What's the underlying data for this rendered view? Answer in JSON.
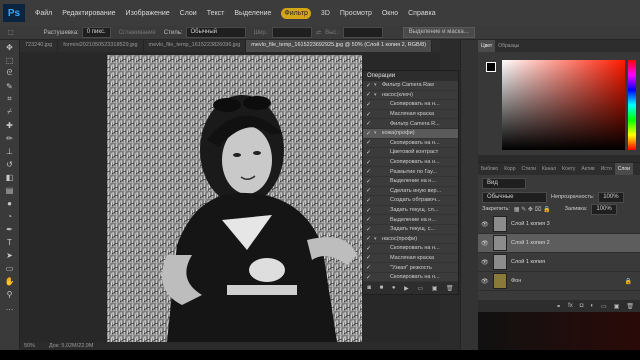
{
  "app": {
    "logo": "Ps"
  },
  "menu": [
    "Файл",
    "Редактирование",
    "Изображение",
    "Слои",
    "Текст",
    "Выделение",
    "Фильтр",
    "3D",
    "Просмотр",
    "Окно",
    "Справка"
  ],
  "menu_highlight_index": 6,
  "options": {
    "feather_label": "Растушевка:",
    "feather_value": "0 пикс.",
    "smoothing_label": "Сглаживание",
    "style_label": "Стиль:",
    "style_value": "Обычный",
    "width_label": "Шир.:",
    "height_label": "Выс.:",
    "refine_button": "Выделение и маска..."
  },
  "tabs": [
    {
      "label": "723240.jpg",
      "active": false
    },
    {
      "label": "formini2021050523318529.jpg",
      "active": false
    },
    {
      "label": "mevlo_file_temp_1615223826096.jpg",
      "active": false
    },
    {
      "label": "mevlo_file_temp_1615223692925.jpg @ 50% (Слой 1 копия 2, RGB/8)",
      "active": true
    }
  ],
  "status": {
    "zoom": "50%",
    "doc": "Док: 5,02M/22,9M"
  },
  "history": {
    "title": "Операции",
    "rows": [
      {
        "text": "Фильтр Camera Raw",
        "arrow": true,
        "sel": false
      },
      {
        "text": "насос(ключ)",
        "arrow": true,
        "sel": false
      },
      {
        "text": "Скопировать на н...",
        "arrow": false,
        "sel": false
      },
      {
        "text": "Масляная краска",
        "arrow": false,
        "sel": false
      },
      {
        "text": "Фильтр Camera R...",
        "arrow": false,
        "sel": false
      },
      {
        "text": "кожа(профи)",
        "arrow": true,
        "sel": true
      },
      {
        "text": "Скопировать на н...",
        "arrow": false,
        "sel": false
      },
      {
        "text": "Цветовой контраст",
        "arrow": false,
        "sel": false
      },
      {
        "text": "Скопировать на н...",
        "arrow": false,
        "sel": false
      },
      {
        "text": "Размытие по Гау...",
        "arrow": false,
        "sel": false
      },
      {
        "text": "Выделение на н...",
        "arrow": false,
        "sel": false
      },
      {
        "text": "Сделать иную вер...",
        "arrow": false,
        "sel": false
      },
      {
        "text": "Создать обтравоч...",
        "arrow": false,
        "sel": false
      },
      {
        "text": "Задать текущ. сл...",
        "arrow": false,
        "sel": false
      },
      {
        "text": "Выделение на н...",
        "arrow": false,
        "sel": false
      },
      {
        "text": "Задать текущ. с...",
        "arrow": false,
        "sel": false
      },
      {
        "text": "насос(профи)",
        "arrow": true,
        "sel": false
      },
      {
        "text": "Скопировать на н...",
        "arrow": false,
        "sel": false
      },
      {
        "text": "Масляная краска",
        "arrow": false,
        "sel": false
      },
      {
        "text": "\"Узкая\" резкость",
        "arrow": false,
        "sel": false
      },
      {
        "text": "Скопировать на н...",
        "arrow": false,
        "sel": false
      }
    ]
  },
  "color_panel": {
    "tabs": [
      "Цвет",
      "Образцы"
    ],
    "fg": "#000000",
    "bg": "#ffffff"
  },
  "layers": {
    "tabs": [
      "Библио",
      "Корр",
      "Стили",
      "Канал",
      "Конту",
      "Актив",
      "Исто",
      "Слои"
    ],
    "filter_label": "Вид",
    "blend_mode": "Обычные",
    "opacity_label": "Непрозрачность:",
    "opacity_value": "100%",
    "lock_label": "Закрепить:",
    "fill_label": "Заливка:",
    "fill_value": "100%",
    "rows": [
      {
        "name": "Слой 1 копия 3",
        "sel": false
      },
      {
        "name": "Слой 1 копия 2",
        "sel": true
      },
      {
        "name": "Слой 1 копия",
        "sel": false
      },
      {
        "name": "Фон",
        "sel": false
      }
    ]
  },
  "tools": [
    "move-icon",
    "marquee-icon",
    "lasso-icon",
    "quick-select-icon",
    "crop-icon",
    "eyedropper-icon",
    "healing-icon",
    "brush-icon",
    "stamp-icon",
    "history-brush-icon",
    "eraser-icon",
    "gradient-icon",
    "blur-icon",
    "dodge-icon",
    "pen-icon",
    "type-icon",
    "path-select-icon",
    "shape-icon",
    "hand-icon",
    "zoom-icon",
    "more-icon"
  ]
}
